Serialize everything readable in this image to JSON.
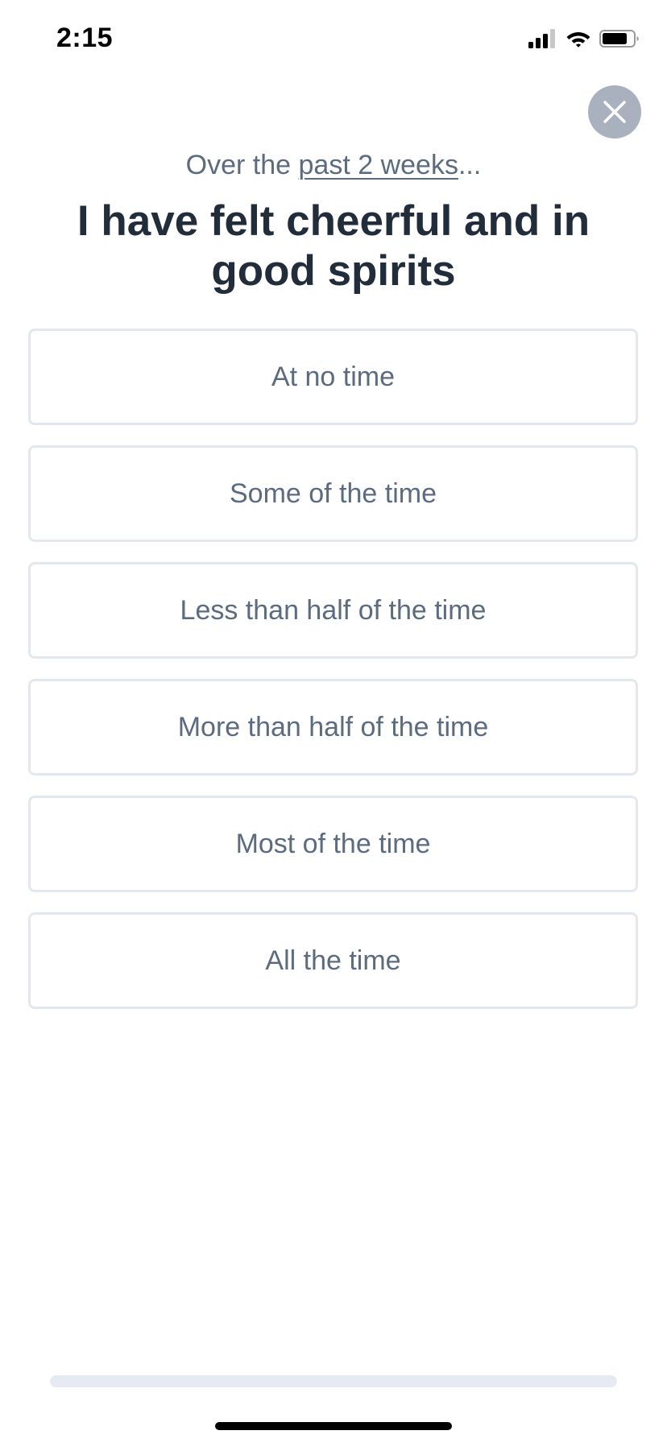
{
  "status_bar": {
    "time": "2:15",
    "icons": [
      "signal-icon",
      "wifi-icon",
      "battery-icon"
    ]
  },
  "close_button": {
    "icon": "close-icon",
    "color": "#a9b1bf"
  },
  "header": {
    "intro_prefix": "Over the ",
    "intro_underlined": "past 2 weeks",
    "intro_suffix": "...",
    "question": "I have felt cheerful and in good spirits"
  },
  "options": [
    {
      "label": "At no time"
    },
    {
      "label": "Some of the time"
    },
    {
      "label": "Less than half of the time"
    },
    {
      "label": "More than half of the time"
    },
    {
      "label": "Most of the time"
    },
    {
      "label": "All the time"
    }
  ],
  "progress": {
    "fraction": 0
  },
  "colors": {
    "heading": "#222d3b",
    "body_text": "#5b6b80",
    "option_border": "#e4e8ee",
    "progress_track": "#e6ebf3"
  }
}
